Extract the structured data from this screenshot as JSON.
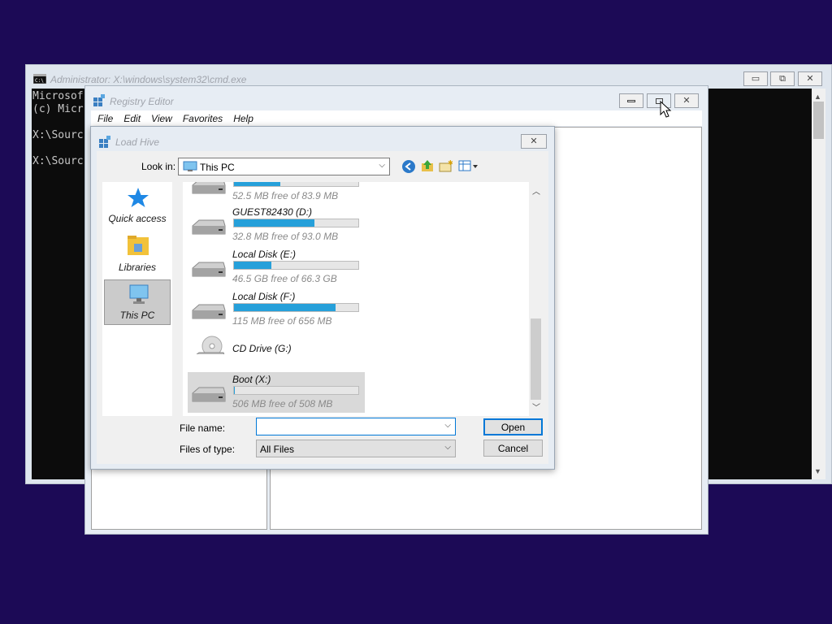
{
  "cmd_window": {
    "title": "Administrator: X:\\windows\\system32\\cmd.exe",
    "lines": [
      "Microsof",
      "(c) Micr",
      "",
      "X:\\Sourc",
      "",
      "X:\\Sourc"
    ],
    "minimize_label": "▭",
    "maximize_label": "⧉",
    "close_label": "✕"
  },
  "registry_editor": {
    "title": "Registry Editor",
    "menu": [
      "File",
      "Edit",
      "View",
      "Favorites",
      "Help"
    ]
  },
  "load_hive": {
    "title": "Load Hive",
    "look_in_label": "Look in:",
    "look_in_value": "This PC",
    "places": [
      {
        "label": "Quick access",
        "icon": "quick-access-star-icon",
        "selected": false
      },
      {
        "label": "Libraries",
        "icon": "libraries-folder-icon",
        "selected": false
      },
      {
        "label": "This PC",
        "icon": "this-pc-monitor-icon",
        "selected": true
      }
    ],
    "drives": [
      {
        "name": "",
        "free": "52.5 MB free of 83.9 MB",
        "used_fraction": 0.37,
        "icon": "hard-drive-icon",
        "selected": false
      },
      {
        "name": "GUEST82430 (D:)",
        "free": "32.8 MB free of 93.0 MB",
        "used_fraction": 0.65,
        "icon": "hard-drive-icon",
        "selected": false
      },
      {
        "name": "Local Disk (E:)",
        "free": "46.5 GB free of 66.3 GB",
        "used_fraction": 0.3,
        "icon": "hard-drive-icon",
        "selected": false
      },
      {
        "name": "Local Disk (F:)",
        "free": "115 MB free of 656 MB",
        "used_fraction": 0.82,
        "icon": "hard-drive-icon",
        "selected": false
      },
      {
        "name": "CD Drive (G:)",
        "free": "",
        "used_fraction": null,
        "icon": "cd-drive-icon",
        "selected": false
      },
      {
        "name": "Boot (X:)",
        "free": "506 MB free of 508 MB",
        "used_fraction": 0.004,
        "icon": "hard-drive-icon",
        "selected": true
      }
    ],
    "file_name_label": "File name:",
    "file_name_value": "",
    "files_of_type_label": "Files of type:",
    "files_of_type_value": "All Files",
    "open_label": "Open",
    "cancel_label": "Cancel",
    "close_label": "✕"
  },
  "colors": {
    "desktop": "#1c0a56",
    "progress": "#26a0da",
    "accent": "#0078d7"
  }
}
